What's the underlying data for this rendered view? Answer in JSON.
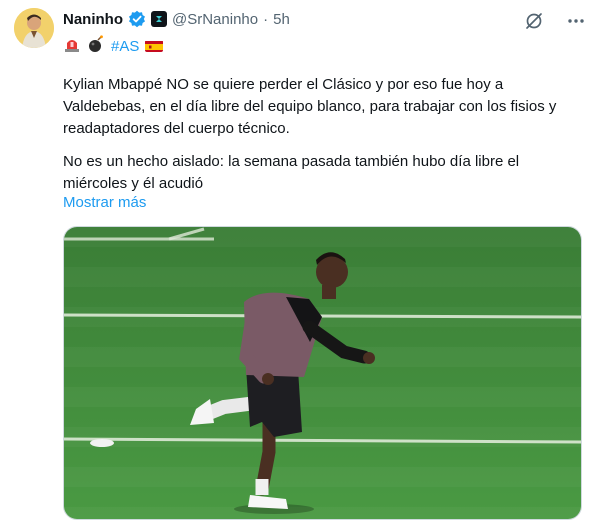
{
  "user": {
    "display_name": "Naninho",
    "handle": "@SrNaninho",
    "separator": "·",
    "time": "5h"
  },
  "tags_line": {
    "hashtag": "#AS"
  },
  "tweet": {
    "paragraph1": "Kylian Mbappé NO se quiere perder el Clásico y por eso fue hoy a Valdebebas, en el día libre del equipo blanco, para trabajar con los fisios y readaptadores del cuerpo técnico.",
    "paragraph2": "No es un hecho aislado: la semana pasada también hubo día libre el miércoles y él acudió",
    "show_more": "Mostrar más"
  },
  "icons": {
    "verified": "verified-badge-icon",
    "affiliate": "affiliate-badge-icon",
    "grok": "grok-icon",
    "more": "more-options-icon",
    "siren": "siren-emoji",
    "bomb": "bomb-emoji",
    "flag": "spain-flag-emoji"
  },
  "colors": {
    "link": "#1d9bf0",
    "text": "#0f1419",
    "muted": "#536471",
    "pitch": "#3f8a3a"
  }
}
